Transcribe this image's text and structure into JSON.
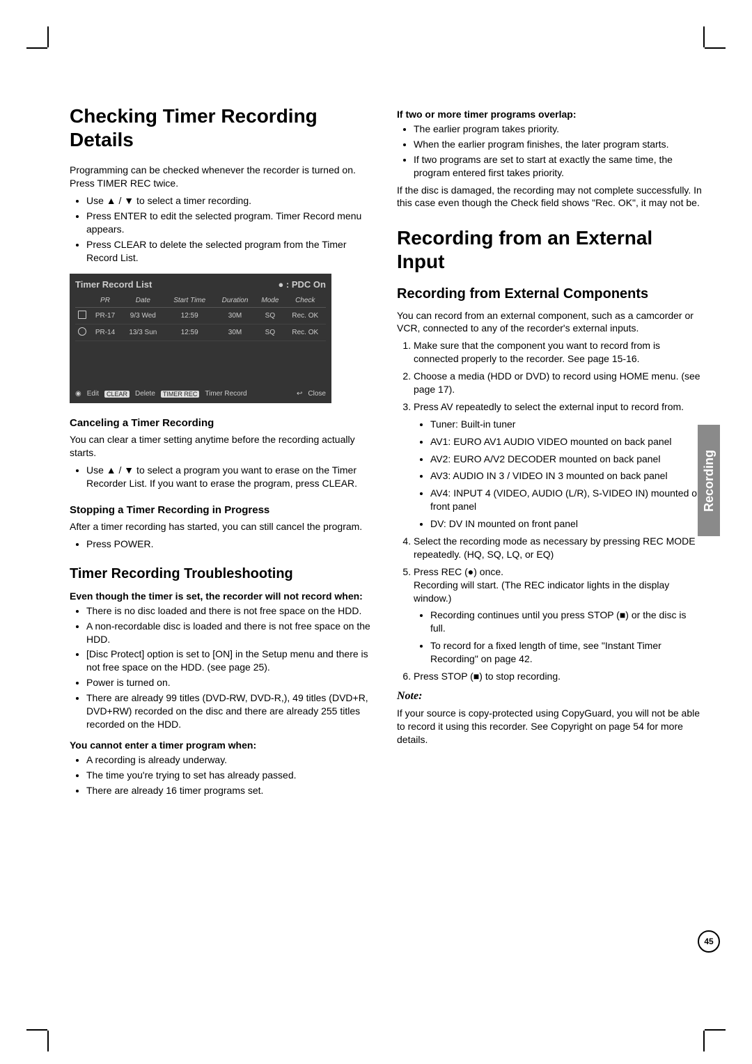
{
  "side_tab": "Recording",
  "page_number": "45",
  "left": {
    "h1": "Checking Timer Recording Details",
    "intro": "Programming can be checked whenever the recorder is turned on. Press TIMER REC twice.",
    "intro_items": [
      "Use ▲ / ▼ to select a timer recording.",
      "Press ENTER to edit the selected program. Timer Record menu appears.",
      "Press CLEAR to delete the selected program from the Timer Record List."
    ],
    "trl": {
      "title": "Timer Record List",
      "pdc": "●  : PDC On",
      "head": [
        "PR",
        "Date",
        "Start Time",
        "Duration",
        "Mode",
        "Check"
      ],
      "rows": [
        {
          "icon": "disc",
          "cells": [
            "PR-17",
            "9/3 Wed",
            "12:59",
            "30M",
            "SQ",
            "Rec. OK"
          ]
        },
        {
          "icon": "hdd",
          "cells": [
            "PR-14",
            "13/3 Sun",
            "12:59",
            "30M",
            "SQ",
            "Rec. OK"
          ]
        }
      ],
      "foot": {
        "edit": "Edit",
        "clear": "CLEAR",
        "delete": "Delete",
        "tr": "TIMER REC",
        "trlabel": "Timer Record",
        "close": "Close",
        "closeicon": "↩"
      }
    },
    "cancel_h": "Canceling a Timer Recording",
    "cancel_p": "You can clear a timer setting anytime before the recording actually starts.",
    "cancel_items": [
      "Use ▲ / ▼ to select a program you want to erase on the Timer Recorder List. If you want to erase the program, press CLEAR."
    ],
    "stop_h": "Stopping a Timer Recording in Progress",
    "stop_p": "After a timer recording has started, you can still cancel the program.",
    "stop_items": [
      "Press POWER."
    ],
    "ts_h2": "Timer Recording Troubleshooting",
    "ts1_h": "Even though the timer is set, the recorder will not record when:",
    "ts1_items": [
      "There is no disc loaded and there is not free space on the HDD.",
      "A non-recordable disc is loaded and there is not free space on the HDD.",
      "[Disc Protect] option is set to [ON] in the Setup menu and there is not free space on the HDD. (see page 25).",
      "Power is turned on.",
      "There are already 99 titles (DVD-RW, DVD-R,), 49 titles (DVD+R, DVD+RW) recorded on the disc and there are already 255 titles recorded on the HDD."
    ],
    "ts2_h": "You cannot enter a timer program when:",
    "ts2_items": [
      "A recording is already underway.",
      "The time you're trying to set has already passed.",
      "There are already 16 timer programs set."
    ]
  },
  "right": {
    "ov_h": "If two or more timer programs overlap:",
    "ov_items": [
      "The earlier program takes priority.",
      "When the earlier program finishes, the later program starts.",
      "If two programs are set to start at exactly the same time, the program entered first takes priority."
    ],
    "ov_p": "If the disc is damaged, the recording may not complete successfully. In this case even though the Check field shows \"Rec. OK\", it may not be.",
    "h1": "Recording from an External Input",
    "h2": "Recording from External Components",
    "p1": "You can record from an external component, such as a camcorder or VCR, connected to any of the recorder's external inputs.",
    "steps": [
      "Make sure that the component you want to record from is connected properly to the recorder. See page 15-16.",
      "Choose a media (HDD or DVD) to record using HOME menu. (see page 17).",
      "Press AV repeatedly to select the external input to record from.",
      "Select the recording mode as necessary by pressing REC MODE repeatedly. (HQ, SQ, LQ, or EQ)",
      "Press REC (●) once.\nRecording will start. (The REC indicator lights in the display window.)",
      "Press STOP (■) to stop recording."
    ],
    "step3_items": [
      "Tuner: Built-in tuner",
      "AV1: EURO AV1 AUDIO VIDEO mounted on back panel",
      "AV2: EURO A/V2 DECODER mounted on back panel",
      "AV3: AUDIO IN 3 / VIDEO IN 3 mounted on back panel",
      "AV4: INPUT 4 (VIDEO, AUDIO (L/R), S-VIDEO IN) mounted on front panel",
      "DV: DV IN mounted on front panel"
    ],
    "step5_items": [
      "Recording continues until you press STOP (■) or the disc is full.",
      "To record for a fixed length of time, see \"Instant Timer Recording\" on page 42."
    ],
    "note_t": "Note:",
    "note_p": "If your source is copy-protected using CopyGuard, you will not be able to record it using this recorder. See Copyright on page 54 for more details."
  }
}
